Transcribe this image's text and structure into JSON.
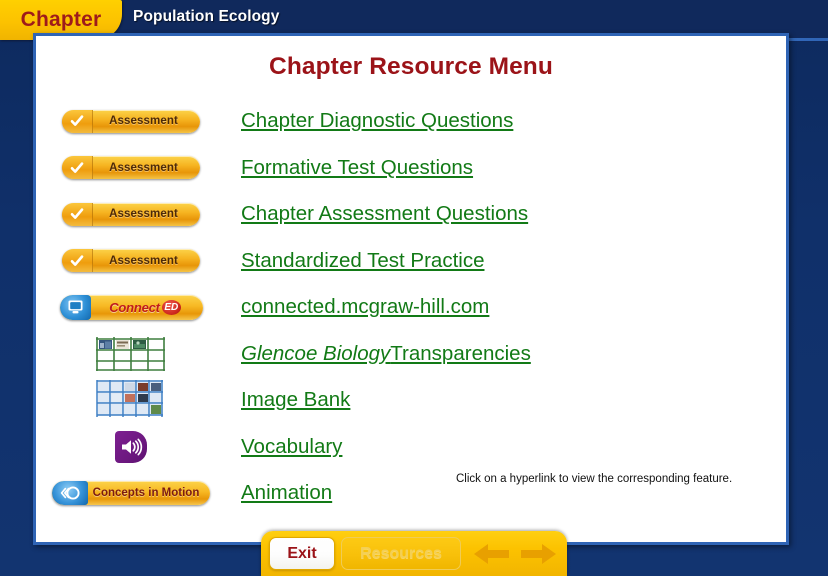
{
  "header": {
    "chapter_tab_label": "Chapter",
    "title": "Population Ecology"
  },
  "main": {
    "menu_title": "Chapter Resource Menu",
    "hint": "Click on a hyperlink to view the corresponding feature.",
    "rows": [
      {
        "icon": "assessment-button-icon",
        "icon_label": "Assessment",
        "link": "Chapter Diagnostic Questions"
      },
      {
        "icon": "assessment-button-icon",
        "icon_label": "Assessment",
        "link": "Formative Test Questions"
      },
      {
        "icon": "assessment-button-icon",
        "icon_label": "Assessment",
        "link": "Chapter Assessment Questions"
      },
      {
        "icon": "assessment-button-icon",
        "icon_label": "Assessment",
        "link": "Standardized Test Practice"
      },
      {
        "icon": "connect-ed-button-icon",
        "icon_label": "Connect",
        "icon_badge": "ED",
        "link": "connected.mcgraw-hill.com"
      },
      {
        "icon": "transparencies-grid-icon",
        "icon_label": "",
        "link_italic": "Glencoe Biology",
        "link_plain": " Transparencies"
      },
      {
        "icon": "image-bank-grid-icon",
        "icon_label": "",
        "link": "Image Bank"
      },
      {
        "icon": "audio-speaker-icon",
        "icon_label": "",
        "link": "Vocabulary"
      },
      {
        "icon": "concepts-in-motion-button-icon",
        "icon_label": "Concepts in Motion",
        "link": "Animation"
      }
    ]
  },
  "toolbar": {
    "exit_label": "Exit",
    "resources_label": "Resources",
    "back_arrow": "back-arrow-icon",
    "forward_arrow": "forward-arrow-icon"
  },
  "colors": {
    "background_navy": "#10295c",
    "tab_gold": "#fcc200",
    "title_red": "#9b1318",
    "link_green": "#127a16",
    "card_border_blue": "#2f64b5",
    "speaker_purple": "#6d1880"
  }
}
